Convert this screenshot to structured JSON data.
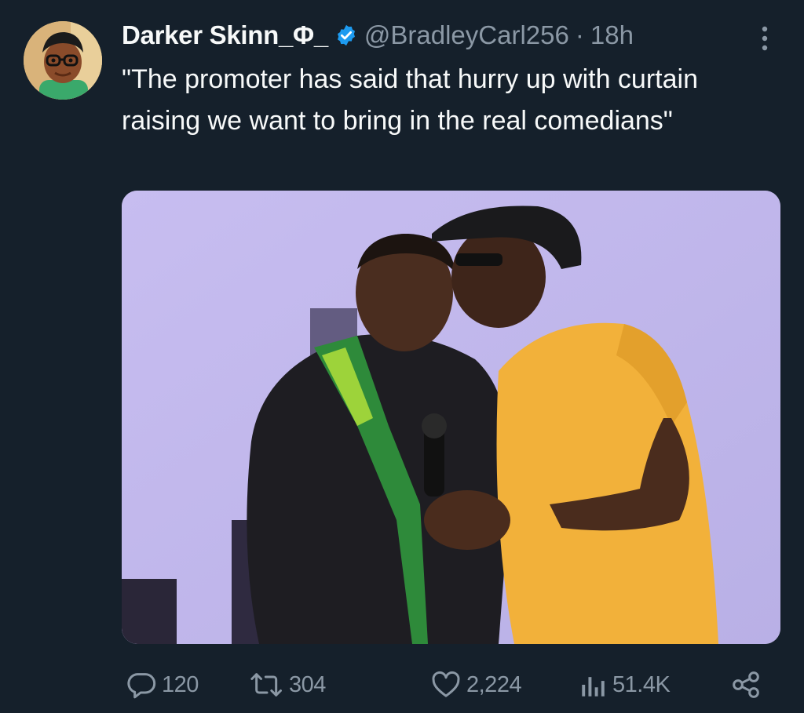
{
  "tweet": {
    "author": {
      "display_name": "Darker Skinn_Φ_",
      "handle": "@BradleyCarl256",
      "verified": true,
      "avatar_icon": "cartoon-avatar"
    },
    "separator": "·",
    "time": "18h",
    "text": "\"The promoter has said that hurry up with curtain raising we want to bring in the real comedians\"",
    "media": {
      "type": "photo"
    },
    "actions": {
      "replies": "120",
      "retweets": "304",
      "likes": "2,224",
      "views": "51.4K"
    }
  },
  "colors": {
    "background": "#15202b",
    "text": "#f7f9f9",
    "secondary": "#8b98a5",
    "verified": "#1d9bf0"
  }
}
